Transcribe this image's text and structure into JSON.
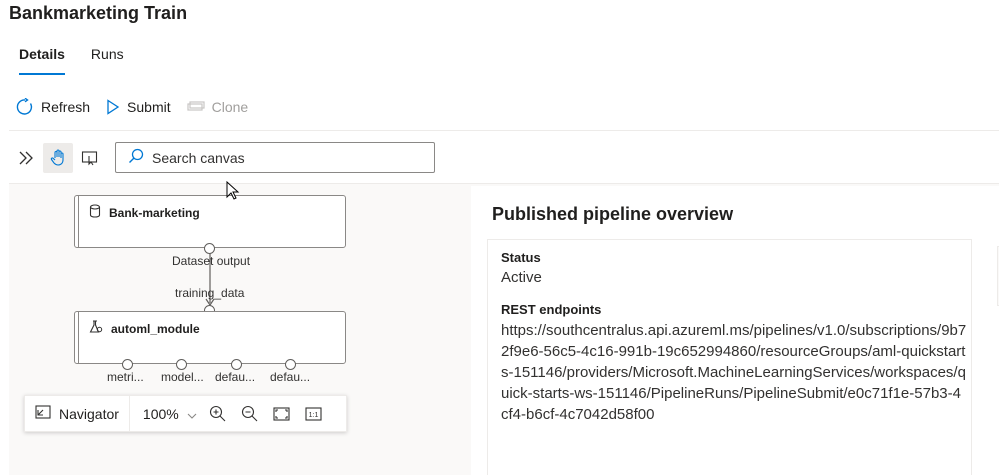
{
  "header": {
    "title": "Bankmarketing Train"
  },
  "tabs": [
    {
      "label": "Details",
      "active": true
    },
    {
      "label": "Runs",
      "active": false
    }
  ],
  "toolbar": {
    "refresh_label": "Refresh",
    "submit_label": "Submit",
    "clone_label": "Clone"
  },
  "canvas": {
    "search_placeholder": "Search canvas",
    "nodes": {
      "dataset": {
        "title": "Bank-marketing",
        "output_label": "Dataset output"
      },
      "automl": {
        "title": "automl_module",
        "input_label": "training_data",
        "output_labels": [
          "metri...",
          "model...",
          "defau...",
          "defau..."
        ]
      }
    },
    "navigator": {
      "label": "Navigator",
      "zoom": "100%"
    }
  },
  "overview": {
    "title": "Published pipeline overview",
    "status_label": "Status",
    "status_value": "Active",
    "endpoints_label": "REST endpoints",
    "endpoint_url": "https://southcentralus.api.azureml.ms/pipelines/v1.0/subscriptions/9b72f9e6-56c5-4c16-991b-19c652994860/resourceGroups/aml-quickstarts-151146/providers/Microsoft.MachineLearningServices/workspaces/quick-starts-ws-151146/PipelineRuns/PipelineSubmit/e0c71f1e-57b3-4cf4-b6cf-4c7042d58f00"
  },
  "colors": {
    "accent": "#0078d4",
    "text": "#201f1e",
    "disabled": "#a19f9d"
  }
}
